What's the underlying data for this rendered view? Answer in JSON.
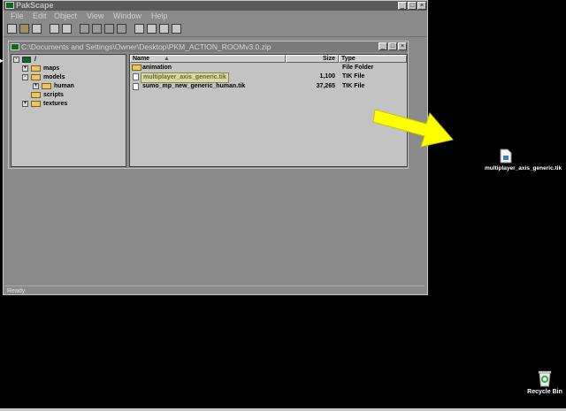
{
  "app": {
    "title": "PakScape",
    "menu": [
      "File",
      "Edit",
      "Object",
      "View",
      "Window",
      "Help"
    ],
    "status": "Ready",
    "controls": {
      "minimize": "_",
      "maximize": "□",
      "close": "×"
    }
  },
  "child_window": {
    "title": "C:\\Documents and Settings\\Owner\\Desktop\\PKM_ACTION_ROOMv3.0.zip"
  },
  "tree": {
    "root": "/",
    "items": [
      {
        "label": "maps",
        "expander": "+"
      },
      {
        "label": "models",
        "expander": "-"
      },
      {
        "label": "human",
        "expander": "+"
      },
      {
        "label": "scripts",
        "expander": ""
      },
      {
        "label": "textures",
        "expander": "+"
      }
    ]
  },
  "list": {
    "columns": [
      "Name",
      "Size",
      "Type"
    ],
    "sort_glyph": "▲",
    "rows": [
      {
        "name": "animation",
        "size": "",
        "type": "File Folder"
      },
      {
        "name": "multiplayer_axis_generic.tik",
        "size": "1,100",
        "type": "TIK File"
      },
      {
        "name": "sumo_mp_new_generic_human.tik",
        "size": "37,265",
        "type": "TIK File"
      }
    ]
  },
  "desktop": {
    "file_label": "multiplayer_axis_generic.tik",
    "recycle_label": "Recycle Bin",
    "left_marker": "▸"
  },
  "colors": {
    "arrow": "#ffff00",
    "folder": "#e8c860",
    "title_icon": "#0a6a20"
  }
}
